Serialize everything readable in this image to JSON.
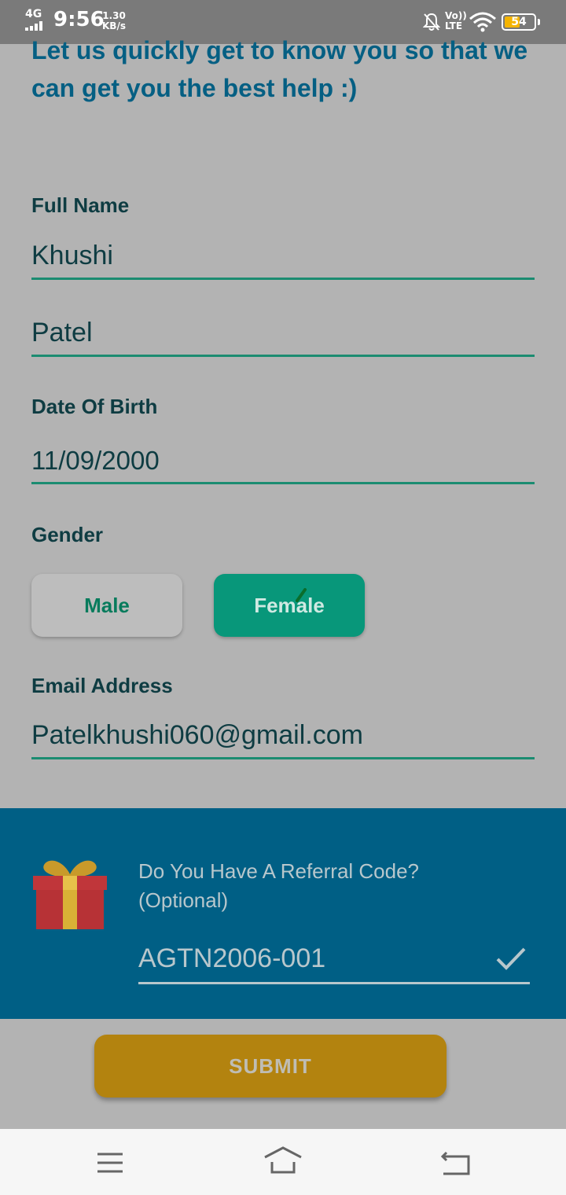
{
  "status_bar": {
    "network": "4G",
    "time": "9:56",
    "speed_value": "1.30",
    "speed_unit": "KB/s",
    "volte_top": "Vo))",
    "volte_bottom": "LTE",
    "battery": "54",
    "battery_level": 0.54
  },
  "intro": {
    "text": "Let us quickly get to know you so that we can get you the best help :)"
  },
  "form": {
    "full_name_label": "Full Name",
    "first_name": "Khushi",
    "last_name": "Patel",
    "dob_label": "Date Of Birth",
    "dob": "11/09/2000",
    "gender_label": "Gender",
    "gender_male": "Male",
    "gender_female": "Female",
    "email_label": "Email Address",
    "email": "Patelkhushi060@gmail.com"
  },
  "referral": {
    "question_line1": "Do You Have A Referral Code?",
    "question_line2": "(Optional)",
    "code": "AGTN2006-001"
  },
  "submit": {
    "label": "SUBMIT"
  },
  "colors": {
    "accent": "#08977a",
    "referral_bg": "#005f85",
    "submit_bg": "#b3830f"
  }
}
